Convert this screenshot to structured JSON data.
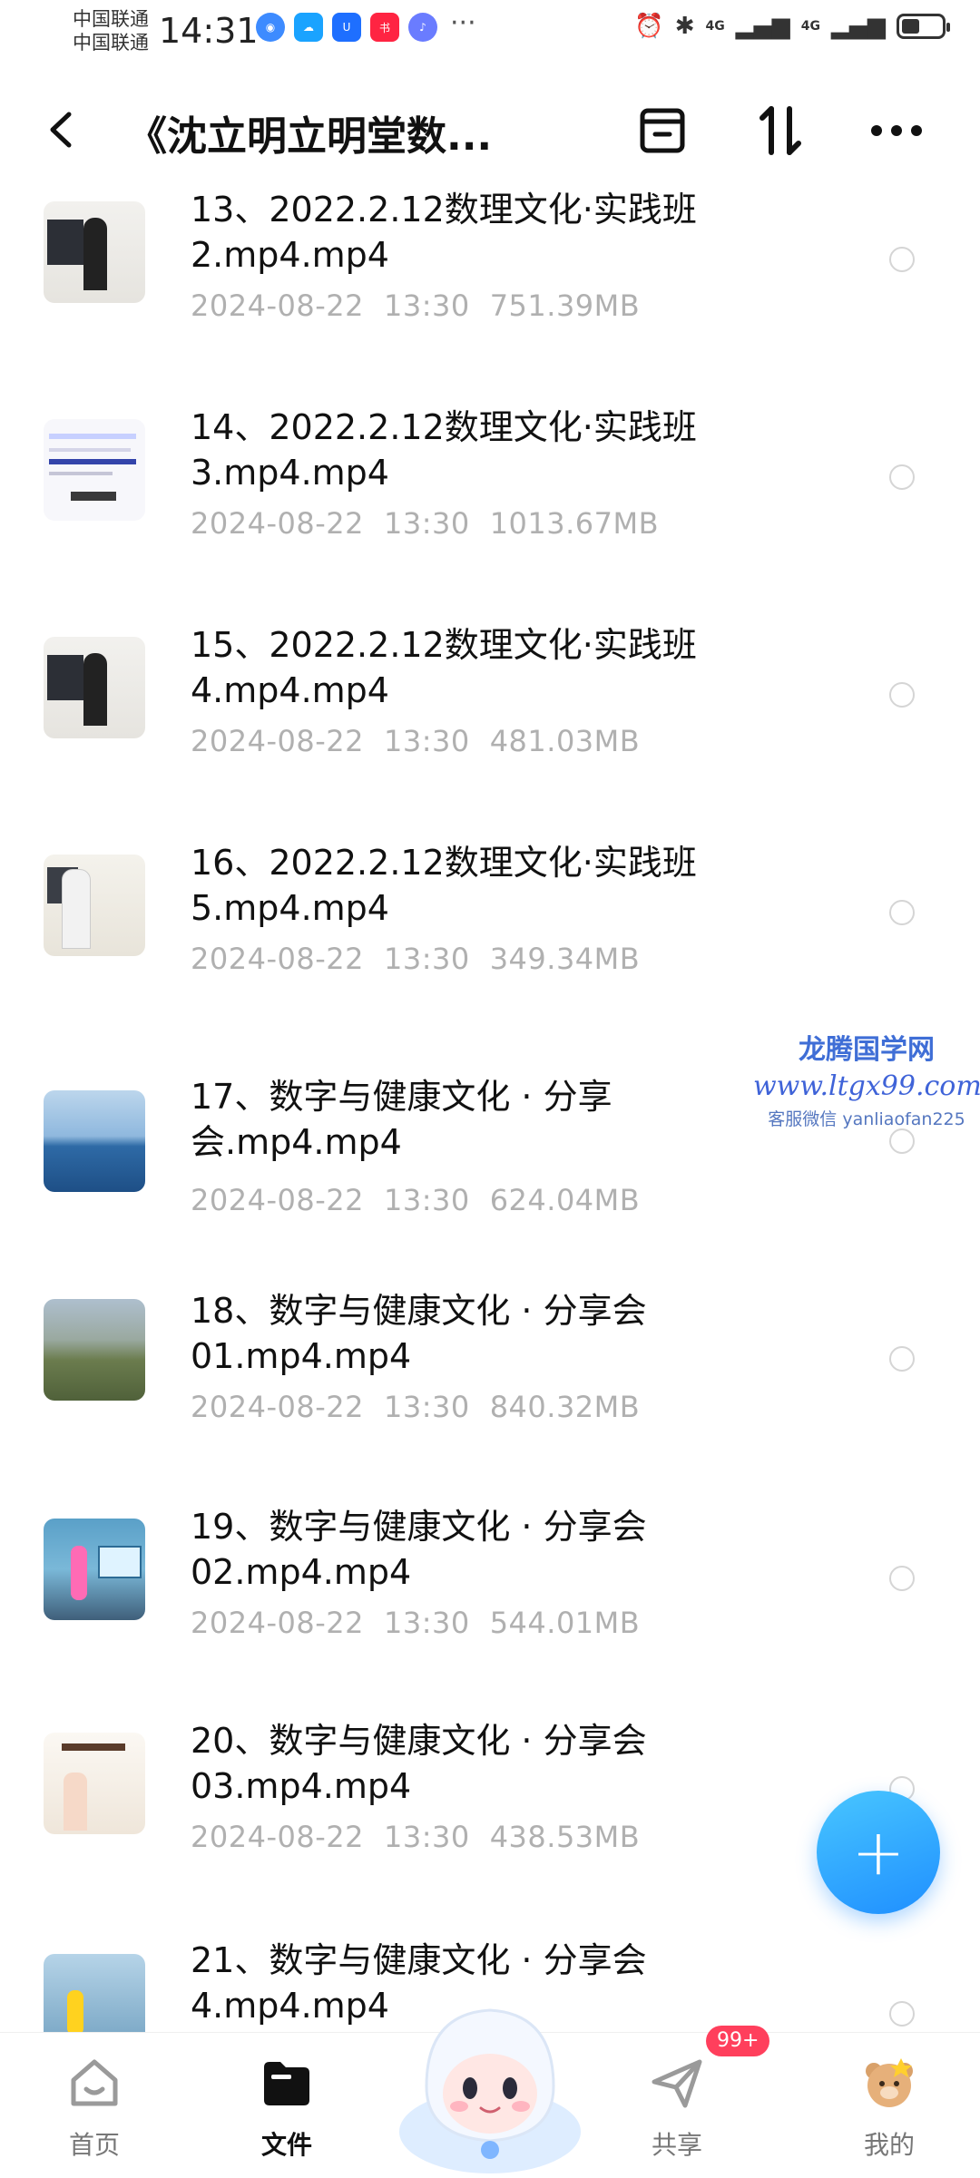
{
  "status_bar": {
    "carrier_1": "中国联通",
    "carrier_2": "中国联通",
    "time": "14:31",
    "more": "···",
    "net_1": "4G",
    "net_2": "4G",
    "app_icons": [
      "browser-icon",
      "weather-icon",
      "app-u-icon",
      "xiaohongshu-icon",
      "music-icon"
    ]
  },
  "header": {
    "title": "《沈立明立明堂数..."
  },
  "files": [
    {
      "name": "13、2022.2.12数理文化·实践班2.mp4.mp4",
      "date": "2024-08-22",
      "time": "13:30",
      "size": "751.39MB"
    },
    {
      "name": "14、2022.2.12数理文化·实践班3.mp4.mp4",
      "date": "2024-08-22",
      "time": "13:30",
      "size": "1013.67MB"
    },
    {
      "name": "15、2022.2.12数理文化·实践班4.mp4.mp4",
      "date": "2024-08-22",
      "time": "13:30",
      "size": "481.03MB"
    },
    {
      "name": "16、2022.2.12数理文化·实践班5.mp4.mp4",
      "date": "2024-08-22",
      "time": "13:30",
      "size": "349.34MB"
    },
    {
      "name": "17、数字与健康文化 · 分享会.mp4.mp4",
      "date": "2024-08-22",
      "time": "13:30",
      "size": "624.04MB"
    },
    {
      "name": "18、数字与健康文化 · 分享会01.mp4.mp4",
      "date": "2024-08-22",
      "time": "13:30",
      "size": "840.32MB"
    },
    {
      "name": "19、数字与健康文化 · 分享会02.mp4.mp4",
      "date": "2024-08-22",
      "time": "13:30",
      "size": "544.01MB"
    },
    {
      "name": "20、数字与健康文化 · 分享会03.mp4.mp4",
      "date": "2024-08-22",
      "time": "13:30",
      "size": "438.53MB"
    },
    {
      "name": "21、数字与健康文化 · 分享会4.mp4.mp4",
      "date": "",
      "time": "",
      "size": ""
    }
  ],
  "watermark": {
    "line1": "龙腾国学网",
    "line2": "www.ltgx99.com",
    "line3": "客服微信 yanliaofan225"
  },
  "fab": {
    "symbol": "+"
  },
  "bottom_nav": {
    "items": [
      {
        "label": "首页",
        "icon": "home-icon",
        "active": false
      },
      {
        "label": "文件",
        "icon": "folder-icon",
        "active": true
      },
      {
        "label": "共享",
        "icon": "share-plane-icon",
        "active": false
      },
      {
        "label": "我的",
        "icon": "bear-avatar-icon",
        "active": false
      }
    ],
    "badge": "99+"
  },
  "colors": {
    "accent": "#1f8fff",
    "badge": "#ff3f5c",
    "meta_text": "#b0b0b0"
  }
}
